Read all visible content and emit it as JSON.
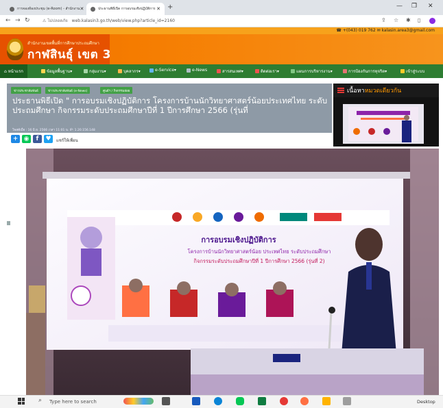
{
  "browser": {
    "tabs": [
      {
        "title": "การจองห้องประชุม (e-Room) - สำนักงาน"
      },
      {
        "title": "ประธานพิธีเปิด การอบรมเชิงปฏิบัติการ"
      }
    ],
    "url_scheme": "ไม่ปลอดภัย",
    "url": "web.kalasin3.go.th/web/view.php?article_id=2160"
  },
  "site": {
    "contact": "☎ +(043) 019 762 ✉ kalasin.area3@gmail.com",
    "org_subtitle": "สำนักงานเขตพื้นที่การศึกษาประถมศึกษา",
    "org_title": "กาฬสินธุ์ เขต 3",
    "menu": [
      "หน้าแรก",
      "ข้อมูลพื้นฐาน",
      "กลุ่มงาน",
      "บุคลากร",
      "e-Service",
      "e-News",
      "สารสนเทศ",
      "ติดต่อเรา",
      "แผนการบริหารงาน",
      "การป้องกันการทุจริต",
      "เข้าสู่ระบบ"
    ]
  },
  "article": {
    "breadcrumbs": [
      "ข่าวประชาสัมพันธ์",
      "ข่าวประชาสัมพันธ์ (e-News)",
      "ศูนย์ฯ / กิจกรรมย่อย"
    ],
    "headline": "ประธานพิธีเปิด \" การอบรมเชิงปฏิบัติการ โครงการบ้านนักวิทยาศาสตร์น้อยประเทศไทย ระดับประถมศึกษา กิจกรรมระดับประถมศึกษาปีที่ 1 ปีการศึกษา 2566 (รุ่นที่",
    "meta": "โพสต์เมื่อ : 16 มิ.ย. 2566 เวลา 11:01 น. IP: 1.20.156.148",
    "share_label": "แชร์ให้เพื่อน"
  },
  "sidebar": {
    "heading_prefix": "เนื้อหา",
    "heading_highlight": "หมวดเดียวกัน"
  },
  "photo": {
    "banner_title": "การอบรมเชิงปฏิบัติการ",
    "banner_line1": "โครงการบ้านนักวิทยาศาสตร์น้อย ประเทศไทย ระดับประถมศึกษา",
    "banner_line2": "กิจกรรมระดับประถมศึกษาปีที่ 1 ปีการศึกษา 2566 (รุ่นที่ 2)"
  },
  "taskbar": {
    "search_placeholder": "Type here to search",
    "desktop_label": "Desktop"
  },
  "colors": {
    "menu_green": "#2e7d32",
    "header_orange": "#f7941d",
    "accent_orange": "#ff9800"
  }
}
